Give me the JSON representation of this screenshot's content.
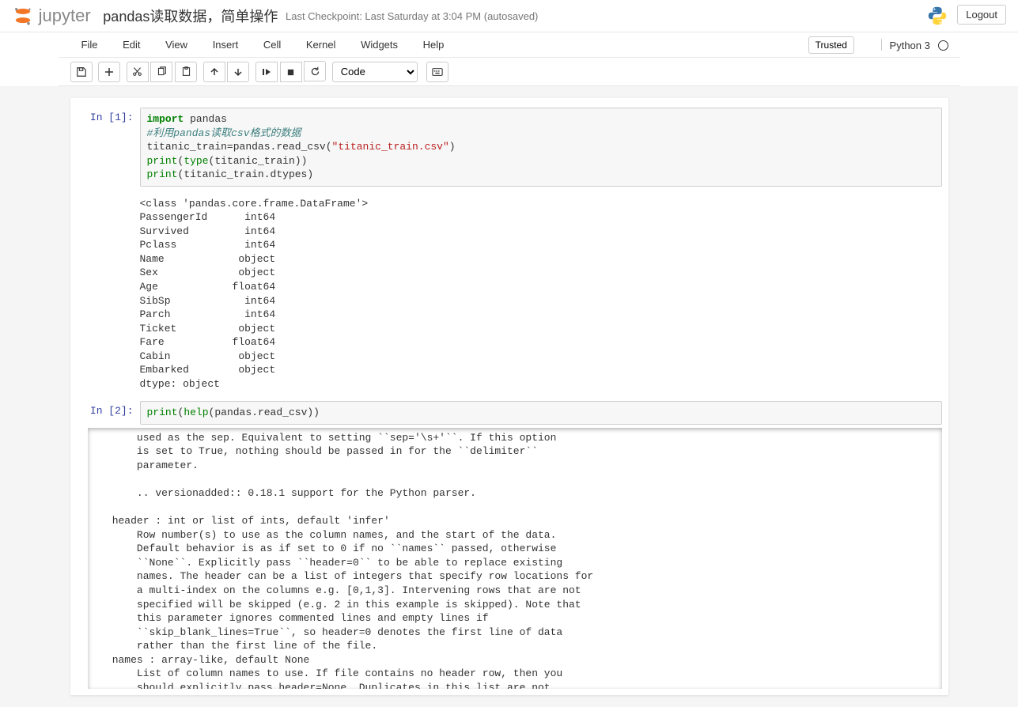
{
  "header": {
    "logo_text": "jupyter",
    "notebook_name": "pandas读取数据，简单操作",
    "checkpoint": "Last Checkpoint: Last Saturday at 3:04 PM (autosaved)",
    "logout": "Logout"
  },
  "menus": {
    "file": "File",
    "edit": "Edit",
    "view": "View",
    "insert": "Insert",
    "cell": "Cell",
    "kernel": "Kernel",
    "widgets": "Widgets",
    "help": "Help"
  },
  "kernel_indicator": {
    "trusted": "Trusted",
    "kernel_name": "Python 3"
  },
  "toolbar": {
    "cell_type_selected": "Code"
  },
  "cells": [
    {
      "prompt": "In  [1]:",
      "code_tokens": [
        {
          "t": "import",
          "c": "cm-keyword"
        },
        {
          "t": " pandas\n",
          "c": ""
        },
        {
          "t": "#利用pandas读取csv格式的数据\n",
          "c": "cm-comment"
        },
        {
          "t": "titanic_train=pandas.read_csv(",
          "c": ""
        },
        {
          "t": "\"titanic_train.csv\"",
          "c": "cm-string"
        },
        {
          "t": ")\n",
          "c": ""
        },
        {
          "t": "print",
          "c": "cm-builtin"
        },
        {
          "t": "(",
          "c": ""
        },
        {
          "t": "type",
          "c": "cm-builtin"
        },
        {
          "t": "(titanic_train))\n",
          "c": ""
        },
        {
          "t": "print",
          "c": "cm-builtin"
        },
        {
          "t": "(titanic_train.dtypes)",
          "c": ""
        }
      ],
      "output": "<class 'pandas.core.frame.DataFrame'>\nPassengerId      int64\nSurvived         int64\nPclass           int64\nName            object\nSex             object\nAge            float64\nSibSp            int64\nParch            int64\nTicket          object\nFare           float64\nCabin           object\nEmbarked        object\ndtype: object"
    },
    {
      "prompt": "In  [2]:",
      "code_tokens": [
        {
          "t": "print",
          "c": "cm-builtin"
        },
        {
          "t": "(",
          "c": ""
        },
        {
          "t": "help",
          "c": "cm-builtin"
        },
        {
          "t": "(pandas.read_csv))",
          "c": ""
        }
      ],
      "output_scroll": "        used as the sep. Equivalent to setting ``sep='\\s+'``. If this option\n        is set to True, nothing should be passed in for the ``delimiter``\n        parameter.\n    \n        .. versionadded:: 0.18.1 support for the Python parser.\n    \n    header : int or list of ints, default 'infer'\n        Row number(s) to use as the column names, and the start of the data.\n        Default behavior is as if set to 0 if no ``names`` passed, otherwise\n        ``None``. Explicitly pass ``header=0`` to be able to replace existing\n        names. The header can be a list of integers that specify row locations for\n        a multi-index on the columns e.g. [0,1,3]. Intervening rows that are not\n        specified will be skipped (e.g. 2 in this example is skipped). Note that\n        this parameter ignores commented lines and empty lines if\n        ``skip_blank_lines=True``, so header=0 denotes the first line of data\n        rather than the first line of the file.\n    names : array-like, default None\n        List of column names to use. If file contains no header row, then you\n        should explicitly pass header=None. Duplicates in this list are not\n        allowed unless mangle_dupe_cols=True, which is the default."
    }
  ]
}
